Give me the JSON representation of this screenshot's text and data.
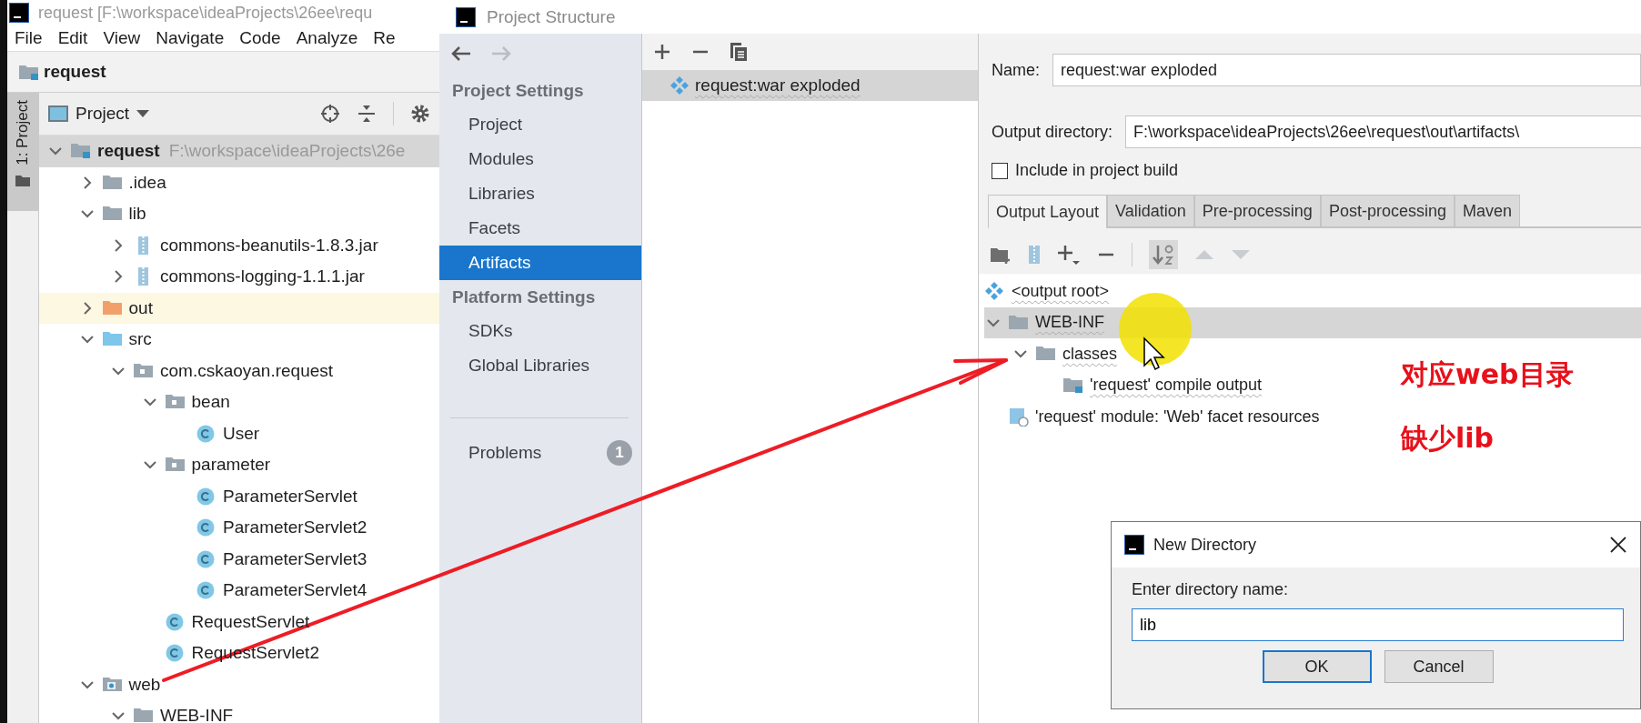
{
  "ide_window": {
    "title": "request [F:\\workspace\\ideaProjects\\26ee\\requ",
    "menu": [
      {
        "label": "File"
      },
      {
        "label": "Edit"
      },
      {
        "label": "View"
      },
      {
        "label": "Navigate"
      },
      {
        "label": "Code"
      },
      {
        "label": "Analyze"
      },
      {
        "label": "Re"
      }
    ],
    "breadcrumb": "request",
    "tool_stripe": "1: Project",
    "project_view": {
      "label": "Project"
    },
    "tree": [
      {
        "label": "request",
        "hint": "F:\\workspace\\ideaProjects\\26e",
        "kind": "module",
        "expanded": true,
        "selected": true,
        "children": [
          {
            "label": ".idea",
            "kind": "folder",
            "expanded": false,
            "selected": false
          },
          {
            "label": "lib",
            "kind": "folder",
            "expanded": true,
            "selected": false,
            "children": [
              {
                "label": "commons-beanutils-1.8.3.jar",
                "kind": "jar",
                "expanded": false,
                "selected": false
              },
              {
                "label": "commons-logging-1.1.1.jar",
                "kind": "jar",
                "expanded": false,
                "selected": false
              }
            ]
          },
          {
            "label": "out",
            "kind": "excluded",
            "expanded": false,
            "selected": false
          },
          {
            "label": "src",
            "kind": "source",
            "expanded": true,
            "selected": false,
            "children": [
              {
                "label": "com.cskaoyan.request",
                "kind": "package",
                "expanded": true,
                "selected": false,
                "children": [
                  {
                    "label": "bean",
                    "kind": "package",
                    "expanded": true,
                    "selected": false,
                    "children": [
                      {
                        "label": "User",
                        "kind": "class",
                        "selected": false
                      }
                    ]
                  },
                  {
                    "label": "parameter",
                    "kind": "package",
                    "expanded": true,
                    "selected": false,
                    "children": [
                      {
                        "label": "ParameterServlet",
                        "kind": "class",
                        "selected": false
                      },
                      {
                        "label": "ParameterServlet2",
                        "kind": "class",
                        "selected": false
                      },
                      {
                        "label": "ParameterServlet3",
                        "kind": "class",
                        "selected": false
                      },
                      {
                        "label": "ParameterServlet4",
                        "kind": "class",
                        "selected": false
                      }
                    ]
                  },
                  {
                    "label": "RequestServlet",
                    "kind": "class",
                    "selected": false
                  },
                  {
                    "label": "RequestServlet2",
                    "kind": "class",
                    "selected": false
                  }
                ]
              }
            ]
          },
          {
            "label": "web",
            "kind": "web",
            "expanded": true,
            "selected": false,
            "children": [
              {
                "label": "WEB-INF",
                "kind": "folder",
                "expanded": true,
                "selected": false
              }
            ]
          }
        ]
      }
    ]
  },
  "project_structure": {
    "title": "Project Structure",
    "nav": [
      {
        "kind": "heading",
        "label": "Project Settings"
      },
      {
        "kind": "item",
        "label": "Project",
        "selected": false
      },
      {
        "kind": "item",
        "label": "Modules",
        "selected": false
      },
      {
        "kind": "item",
        "label": "Libraries",
        "selected": false
      },
      {
        "kind": "item",
        "label": "Facets",
        "selected": false
      },
      {
        "kind": "item",
        "label": "Artifacts",
        "selected": true
      },
      {
        "kind": "heading",
        "label": "Platform Settings"
      },
      {
        "kind": "item",
        "label": "SDKs",
        "selected": false
      },
      {
        "kind": "item",
        "label": "Global Libraries",
        "selected": false
      }
    ],
    "problems": {
      "label": "Problems",
      "badge": "1"
    },
    "artifacts": [
      {
        "label": "request:war exploded",
        "selected": true
      }
    ],
    "name_label": "Name:",
    "name_value": "request:war exploded",
    "output_label": "Output directory:",
    "output_value": "F:\\workspace\\ideaProjects\\26ee\\request\\out\\artifacts\\",
    "include_build": {
      "label": "Include in project build",
      "checked": false
    },
    "tabs": [
      {
        "label": "Output Layout",
        "selected": true
      },
      {
        "label": "Validation",
        "selected": false
      },
      {
        "label": "Pre-processing",
        "selected": false
      },
      {
        "label": "Post-processing",
        "selected": false
      },
      {
        "label": "Maven",
        "selected": false
      }
    ],
    "layout_tree": [
      {
        "label": "<output root>",
        "kind": "artifact",
        "selected": false,
        "children": [
          {
            "label": "WEB-INF",
            "kind": "folder",
            "expanded": true,
            "selected": true,
            "children": [
              {
                "label": "classes",
                "kind": "folder",
                "expanded": true,
                "selected": false,
                "children": [
                  {
                    "label": "'request' compile output",
                    "kind": "compile",
                    "selected": false
                  }
                ]
              }
            ]
          },
          {
            "label": "'request' module: 'Web' facet resources",
            "kind": "facet",
            "selected": false
          }
        ]
      }
    ]
  },
  "annotations": [
    {
      "text": "对应web目录",
      "color": "#e8101a"
    },
    {
      "text": "缺少lib",
      "color": "#e8101a"
    }
  ],
  "new_directory_dialog": {
    "title": "New Directory",
    "prompt": "Enter directory name:",
    "value": "lib",
    "buttons": [
      {
        "label": "OK",
        "default": true
      },
      {
        "label": "Cancel",
        "default": false
      }
    ]
  }
}
